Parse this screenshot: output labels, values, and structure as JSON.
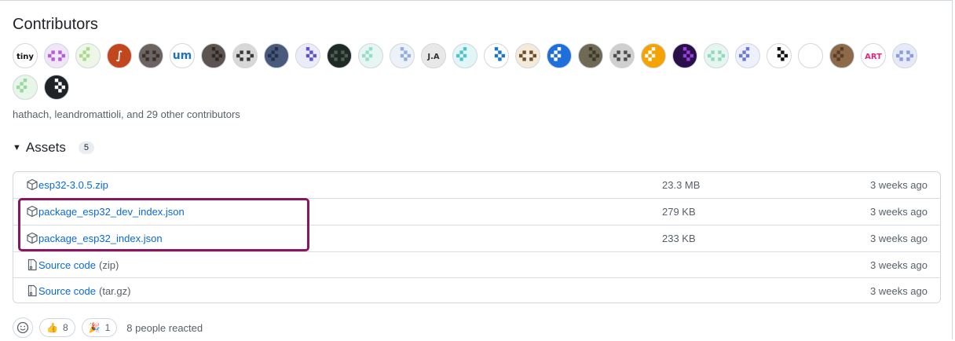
{
  "contributors": {
    "title": "Contributors",
    "summary": "hathach, leandromattioli, and 29 other contributors",
    "avatars": [
      {
        "label": "tiny",
        "bg": "#ffffff",
        "fg": "#111111"
      },
      {
        "label": "",
        "bg": "#f1e6f8",
        "fg": "#b25ed4"
      },
      {
        "label": "",
        "bg": "#eef6e8",
        "fg": "#a9d98a"
      },
      {
        "label": "∫",
        "bg": "#c2471c",
        "fg": "#ffffff"
      },
      {
        "label": "",
        "bg": "#6b6460",
        "fg": "#3b322c"
      },
      {
        "label": "um",
        "bg": "#ffffff",
        "fg": "#1e73be"
      },
      {
        "label": "",
        "bg": "#5b5450",
        "fg": "#2f2824"
      },
      {
        "label": "",
        "bg": "#d8d8d8",
        "fg": "#3a3a3a"
      },
      {
        "label": "",
        "bg": "#4a5a7a",
        "fg": "#253050"
      },
      {
        "label": "",
        "bg": "#ecebfa",
        "fg": "#5a55c9"
      },
      {
        "label": "",
        "bg": "#1f2a25",
        "fg": "#4e5e55"
      },
      {
        "label": "",
        "bg": "#e6f6f3",
        "fg": "#96dcc9"
      },
      {
        "label": "",
        "bg": "#edf1f8",
        "fg": "#92aee0"
      },
      {
        "label": "J.A",
        "bg": "#e8e8e8",
        "fg": "#333333"
      },
      {
        "label": "",
        "bg": "#e3f6f7",
        "fg": "#4fc3cc"
      },
      {
        "label": "",
        "bg": "#ffffff",
        "fg": "#1b78c7"
      },
      {
        "label": "",
        "bg": "#f3ead9",
        "fg": "#6b4f2b"
      },
      {
        "label": "",
        "bg": "#1e6fd9",
        "fg": "#ffffff"
      },
      {
        "label": "",
        "bg": "#6e6a55",
        "fg": "#3c3a2c"
      },
      {
        "label": "",
        "bg": "#cfcfcf",
        "fg": "#4d4d4d"
      },
      {
        "label": "",
        "bg": "#f5a300",
        "fg": "#ffffff"
      },
      {
        "label": "",
        "bg": "#2a0f4a",
        "fg": "#9a3ee0"
      },
      {
        "label": "",
        "bg": "#e5f5ef",
        "fg": "#8fd9bc"
      },
      {
        "label": "",
        "bg": "#eef0fb",
        "fg": "#6c78d9"
      },
      {
        "label": "",
        "bg": "#ffffff",
        "fg": "#111111"
      },
      {
        "label": "",
        "bg": "#ffffff",
        "fg": "#ffffff"
      },
      {
        "label": "",
        "bg": "#8c6a4a",
        "fg": "#5a3e26"
      },
      {
        "label": "ART",
        "bg": "#ffffff",
        "fg": "#e2257e"
      },
      {
        "label": "",
        "bg": "#e6e9f7",
        "fg": "#8d9ae0"
      },
      {
        "label": "",
        "bg": "#e8f6ea",
        "fg": "#98d6a2"
      },
      {
        "label": "",
        "bg": "#1f2328",
        "fg": "#ffffff"
      }
    ]
  },
  "assets": {
    "title": "Assets",
    "count": "5",
    "items": [
      {
        "name": "esp32-3.0.5.zip",
        "suffix": "",
        "size": "23.3 MB",
        "time": "3 weeks ago",
        "icon": "package-icon"
      },
      {
        "name": "package_esp32_dev_index.json",
        "suffix": "",
        "size": "279 KB",
        "time": "3 weeks ago",
        "icon": "package-icon"
      },
      {
        "name": "package_esp32_index.json",
        "suffix": "",
        "size": "233 KB",
        "time": "3 weeks ago",
        "icon": "package-icon"
      },
      {
        "name": "Source code",
        "suffix": "(zip)",
        "size": "",
        "time": "3 weeks ago",
        "icon": "file-zip-icon"
      },
      {
        "name": "Source code",
        "suffix": "(tar.gz)",
        "size": "",
        "time": "3 weeks ago",
        "icon": "file-zip-icon"
      }
    ]
  },
  "reactions": {
    "thumbs_count": "8",
    "thumbs_emoji": "👍",
    "tada_count": "1",
    "tada_emoji": "🎉",
    "summary": "8 people reacted"
  },
  "colors": {
    "link": "#0969da",
    "highlight_border": "#8c155f",
    "muted_text": "#57606a"
  }
}
